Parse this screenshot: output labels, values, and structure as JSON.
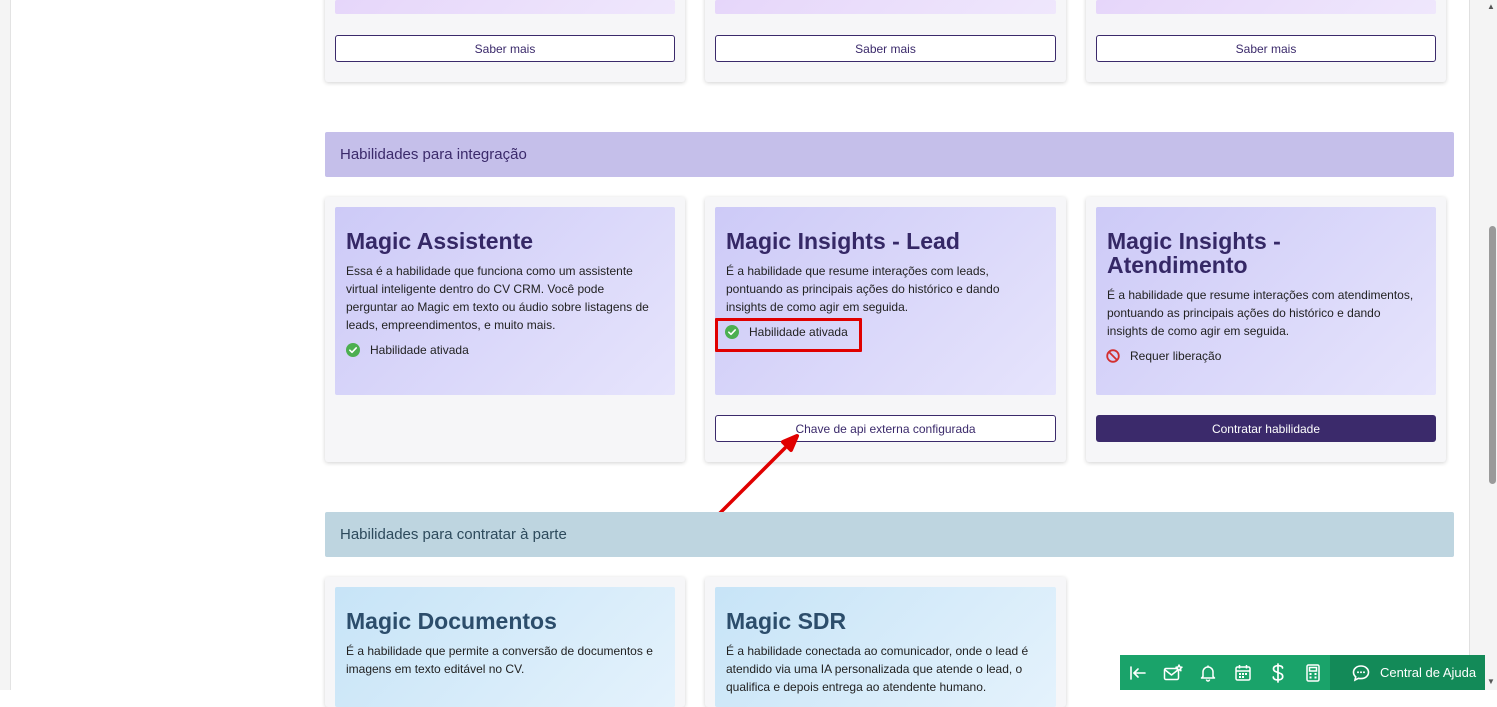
{
  "top_cards": [
    {
      "button_label": "Saber mais"
    },
    {
      "button_label": "Saber mais"
    },
    {
      "button_label": "Saber mais"
    }
  ],
  "sections": {
    "integration": "Habilidades para integração",
    "separate": "Habilidades para contratar à parte"
  },
  "integration_cards": [
    {
      "title": "Magic Assistente",
      "description": "Essa é a habilidade que funciona como um assistente virtual inteligente dentro do CV CRM. Você pode perguntar ao Magic em texto ou áudio sobre listagens de leads, empreendimentos, e muito mais.",
      "status": "Habilidade ativada"
    },
    {
      "title": "Magic Insights - Lead",
      "description": "É a habilidade que resume interações com leads, pontuando as principais ações do histórico e dando insights de como agir em seguida.",
      "status": "Habilidade ativada",
      "button_label": "Chave de api externa configurada"
    },
    {
      "title_line1": "Magic Insights -",
      "title_line2": "Atendimento",
      "description": "É a habilidade que resume interações com atendimentos, pontuando as principais ações do histórico e dando insights de como agir em seguida.",
      "status": "Requer liberação",
      "button_label": "Contratar habilidade"
    }
  ],
  "separate_cards": [
    {
      "title": "Magic Documentos",
      "description": "É a habilidade que permite a conversão de documentos e imagens em texto editável no CV."
    },
    {
      "title": "Magic SDR",
      "description": "É a habilidade conectada ao comunicador, onde o lead é atendido via uma IA personalizada que atende o lead, o qualifica e depois entrega ao atendente humano."
    }
  ],
  "bottom_bar": {
    "icons": [
      "collapse-left-icon",
      "mail-star-icon",
      "bell-icon",
      "calendar-icon",
      "dollar-icon",
      "calculator-icon"
    ],
    "help_label": "Central de Ajuda"
  },
  "colors": {
    "accent": "#3b2a6b",
    "status_ok": "#4caf50",
    "status_blocked": "#d32f2f",
    "highlight": "#e00000",
    "bottom_bar": "#1aa36a"
  }
}
